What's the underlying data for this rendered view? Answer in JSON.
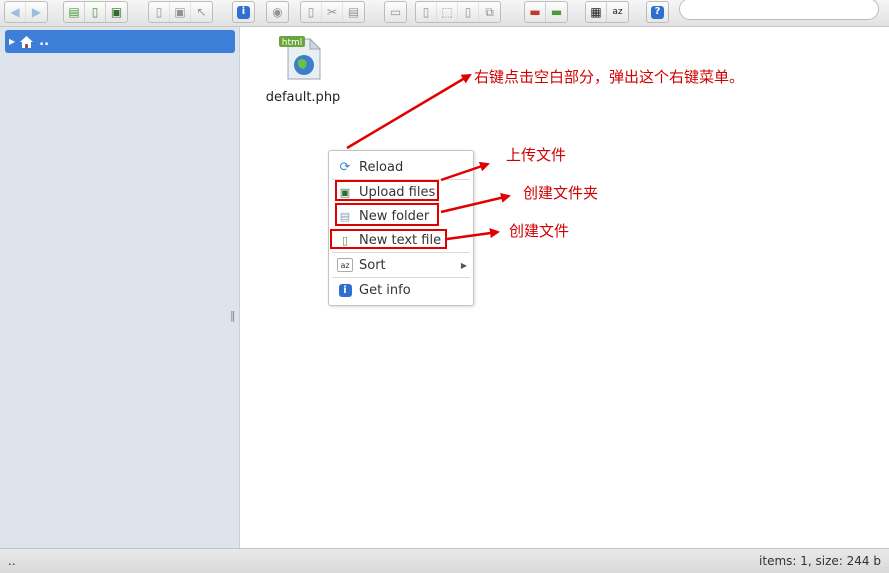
{
  "toolbar": {
    "groups": [
      [
        "back-icon",
        "forward-icon"
      ],
      [
        "new-folder-icon",
        "new-file-icon",
        "save-icon"
      ],
      [
        "copy-doc-icon",
        "save-disk-icon",
        "select-icon"
      ],
      [
        "info-icon"
      ],
      [
        "view-icon"
      ],
      [
        "copy-icon",
        "cut-icon",
        "paste-icon"
      ],
      [
        "edit-icon"
      ],
      [
        "duplicate-icon",
        "select-all-icon",
        "rename-icon",
        "resize-icon"
      ],
      [
        "extract-icon",
        "archive-icon"
      ],
      [
        "grid-view-icon",
        "sort-icon"
      ],
      [
        "help-icon"
      ]
    ],
    "search_placeholder": ""
  },
  "sidebar": {
    "root_label": ".."
  },
  "main": {
    "file": {
      "name": "default.php",
      "icon_badge": "html"
    }
  },
  "context_menu": {
    "items": [
      {
        "label": "Reload",
        "icon": "reload-icon"
      },
      {
        "label": "Upload files",
        "icon": "upload-icon"
      },
      {
        "label": "New folder",
        "icon": "new-folder-icon"
      },
      {
        "label": "New text file",
        "icon": "new-text-file-icon"
      },
      {
        "label": "Sort",
        "icon": "sort-icon"
      },
      {
        "label": "Get info",
        "icon": "info-icon"
      }
    ]
  },
  "annotations": {
    "right_click": "右键点击空白部分，弹出这个右键菜单。",
    "upload": "上传文件",
    "new_folder": "创建文件夹",
    "new_file": "创建文件"
  },
  "statusbar": {
    "path": "..",
    "summary": "items: 1, size: 244 b"
  },
  "colors": {
    "accent": "#3c7ed8",
    "annotation": "#e00000",
    "sidebar_bg": "#dde4ec"
  }
}
